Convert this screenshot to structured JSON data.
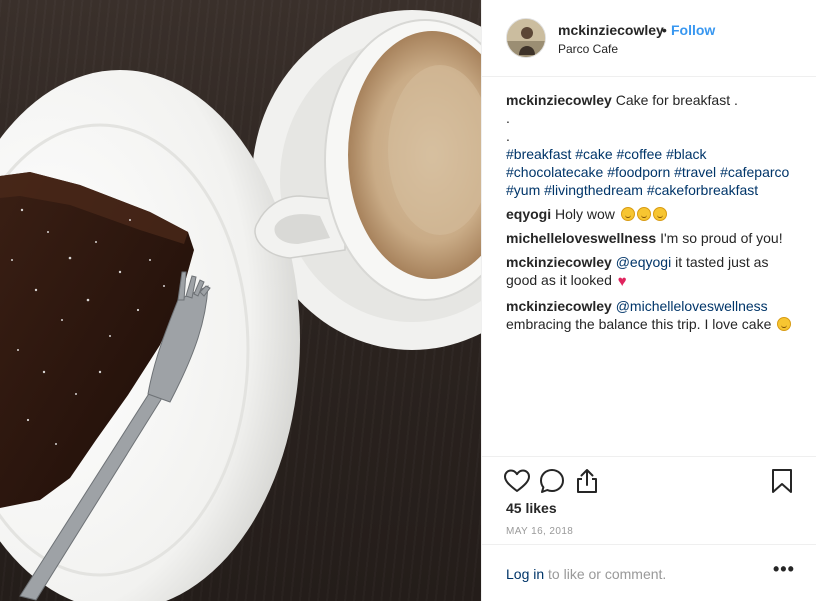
{
  "header": {
    "username": "mckinziecowley",
    "separator": "•",
    "follow_label": "Follow",
    "location": "Parco Cafe"
  },
  "caption": {
    "username": "mckinziecowley",
    "text": "Cake for breakfast .",
    "dot_lines": [
      ".",
      "."
    ],
    "hashtags": [
      "#breakfast",
      "#cake",
      "#coffee",
      "#black",
      "#chocolatecake",
      "#foodporn",
      "#travel",
      "#cafeparco",
      "#yum",
      "#livingthedream",
      "#cakeforbreakfast"
    ]
  },
  "comments": [
    {
      "username": "eqyogi",
      "text": "Holy wow",
      "emoji": [
        "grinning-face",
        "grinning-face",
        "grinning-face"
      ]
    },
    {
      "username": "michelleloveswellness",
      "text": "I'm so proud of you!"
    },
    {
      "username": "mckinziecowley",
      "mention": "@eqyogi",
      "text": "it tasted just as good as it looked",
      "emoji": [
        "red-heart"
      ]
    },
    {
      "username": "mckinziecowley",
      "mention": "@michelleloveswellness",
      "text": "embracing the balance this trip. I love cake",
      "emoji": [
        "grinning-face"
      ]
    }
  ],
  "actions": {
    "icons": [
      "heart-icon",
      "comment-icon",
      "share-icon",
      "bookmark-icon"
    ]
  },
  "likes": "45 likes",
  "date": "MAY 16, 2018",
  "footer": {
    "login_link": "Log in",
    "login_rest": " to like or comment.",
    "more_label": "•••"
  },
  "colors": {
    "link_blue": "#3897f0",
    "hashtag_blue": "#003569",
    "text": "#262626",
    "muted": "#999999"
  }
}
